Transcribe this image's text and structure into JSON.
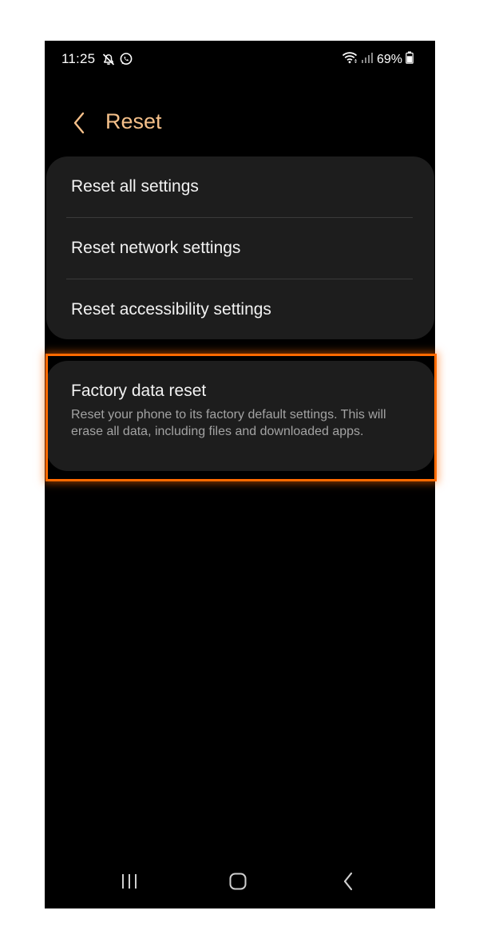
{
  "status_bar": {
    "time": "11:25",
    "battery_percent": "69%",
    "left_icons": [
      "mute-notifications-icon",
      "whatsapp-icon"
    ],
    "right_icons": [
      "wifi-icon",
      "signal-icon",
      "battery-icon"
    ]
  },
  "header": {
    "title": "Reset",
    "back_icon": "chevron-left-icon",
    "accent_color": "#f5c08a"
  },
  "reset_options": [
    {
      "label": "Reset all settings"
    },
    {
      "label": "Reset network settings"
    },
    {
      "label": "Reset accessibility settings"
    }
  ],
  "factory_reset": {
    "title": "Factory data reset",
    "description": "Reset your phone to its factory default settings. This will erase all data, including files and downloaded apps.",
    "highlight_color": "#ff6a00"
  },
  "nav_bar": {
    "items": [
      "recent-apps-icon",
      "home-icon",
      "back-icon"
    ]
  }
}
